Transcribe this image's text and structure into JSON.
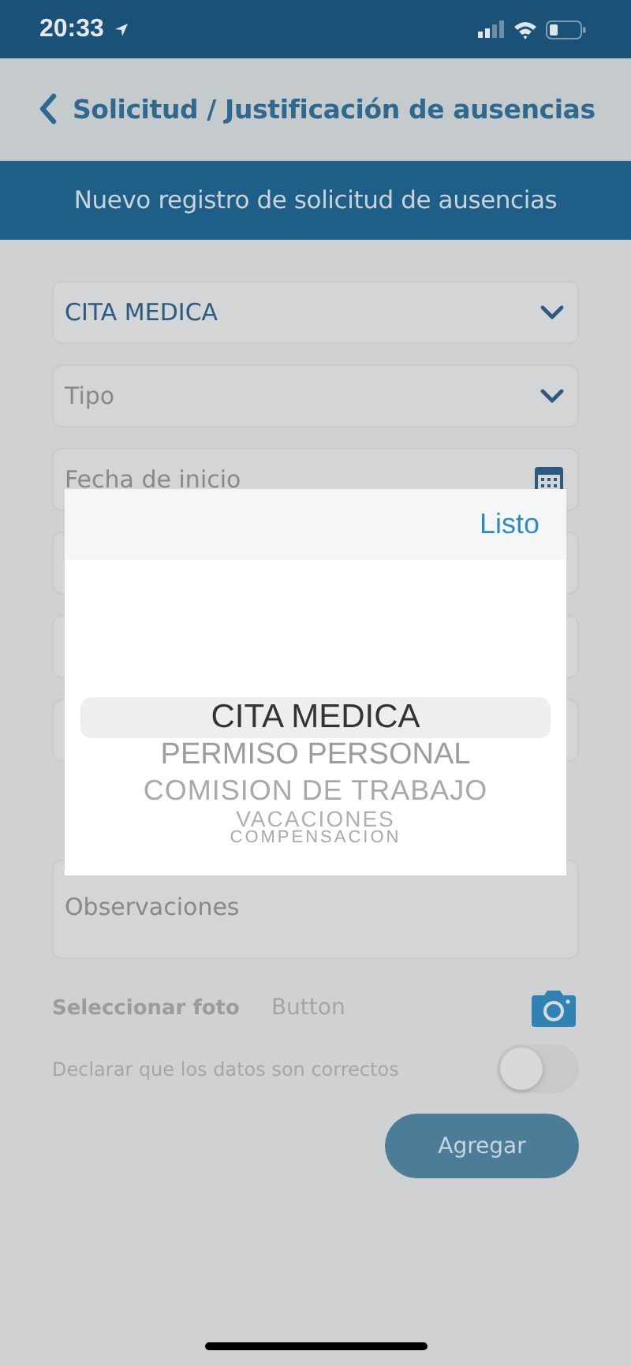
{
  "status_bar": {
    "time": "20:33"
  },
  "nav": {
    "title": "Solicitud / Justificación de ausencias"
  },
  "header": {
    "title": "Nuevo registro de solicitud de ausencias"
  },
  "form": {
    "fields": [
      {
        "kind": "select",
        "value": "CITA MEDICA"
      },
      {
        "kind": "select",
        "placeholder": "Tipo"
      },
      {
        "kind": "date",
        "placeholder": "Fecha de inicio"
      }
    ],
    "observations": {
      "placeholder": "Observaciones"
    },
    "photo": {
      "label": "Seleccionar foto",
      "button": "Button"
    },
    "declaration": {
      "label": "Declarar que los datos son correctos",
      "on": false
    },
    "submit": "Agregar"
  },
  "picker": {
    "done": "Listo",
    "options": [
      {
        "label": "CITA MEDICA",
        "selected": true
      },
      {
        "label": "PERMISO PERSONAL",
        "selected": false
      },
      {
        "label": "COMISION DE TRABAJO",
        "selected": false
      },
      {
        "label": "VACACIONES",
        "selected": false
      },
      {
        "label": "COMPENSACION",
        "selected": false
      }
    ]
  }
}
